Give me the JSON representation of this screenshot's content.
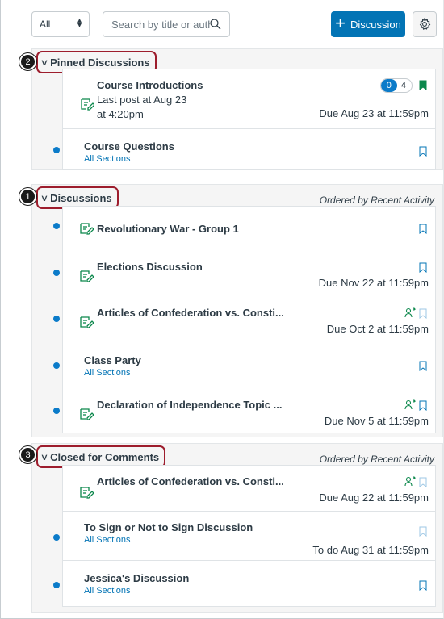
{
  "toolbar": {
    "filter_value": "All",
    "search_placeholder": "Search by title or author",
    "add_discussion_label": "Discussion"
  },
  "groups": [
    {
      "title": "Pinned Discussions",
      "callout": "2",
      "ordered_by": "",
      "items": [
        {
          "title": "Course Introductions",
          "last_post": "Last post at Aug 23 at 4:20pm",
          "unread_count": "0",
          "reply_count": "4",
          "due": "Due Aug 23 at 11:59pm"
        },
        {
          "title": "Course Questions",
          "sections": "All Sections"
        }
      ]
    },
    {
      "title": "Discussions",
      "callout": "1",
      "ordered_by": "Ordered by Recent Activity",
      "items": [
        {
          "title": "Revolutionary War - Group 1"
        },
        {
          "title": "Elections Discussion",
          "due": "Due Nov 22 at 11:59pm"
        },
        {
          "title": "Articles of Confederation vs. Consti...",
          "due": "Due Oct 2 at 11:59pm"
        },
        {
          "title": "Class Party",
          "sections": "All Sections"
        },
        {
          "title": "Declaration of Independence Topic ...",
          "due": "Due Nov 5 at 11:59pm"
        }
      ]
    },
    {
      "title": "Closed for Comments",
      "callout": "3",
      "ordered_by": "Ordered by Recent Activity",
      "items": [
        {
          "title": "Articles of Confederation vs. Consti...",
          "due": "Due Aug 22 at 11:59pm"
        },
        {
          "title": "To Sign or Not to Sign Discussion",
          "sections": "All Sections",
          "due": "To do Aug 31 at 11:59pm"
        },
        {
          "title": "Jessica's Discussion",
          "sections": "All Sections"
        }
      ]
    }
  ],
  "colors": {
    "accent": "#0374b5",
    "unread": "#0b7bc9",
    "assignment_icon": "#0b874b",
    "callout_border": "#9d1d2d"
  }
}
